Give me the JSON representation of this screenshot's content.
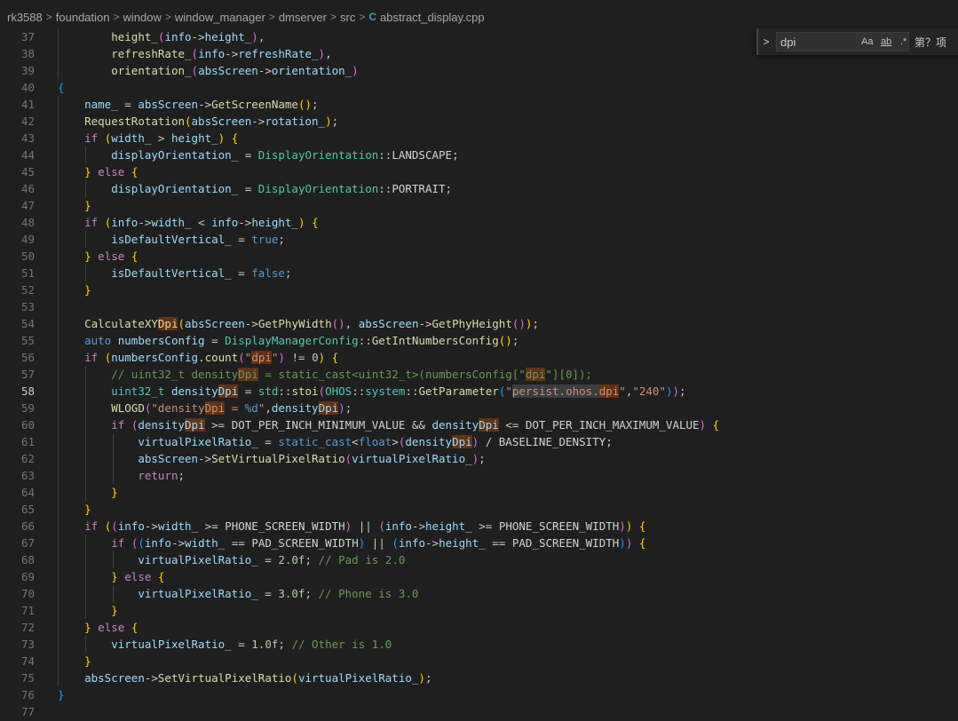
{
  "breadcrumb": {
    "items": [
      "rk3588",
      "foundation",
      "window",
      "window_manager",
      "dmserver",
      "src"
    ],
    "file_icon": "C",
    "file": "abstract_display.cpp"
  },
  "find": {
    "query": "dpi",
    "match_case_label": "Aa",
    "whole_word_label": "ab",
    "regex_label": ".*",
    "result_text": "第？项"
  },
  "editor": {
    "current_line": 58
  }
}
